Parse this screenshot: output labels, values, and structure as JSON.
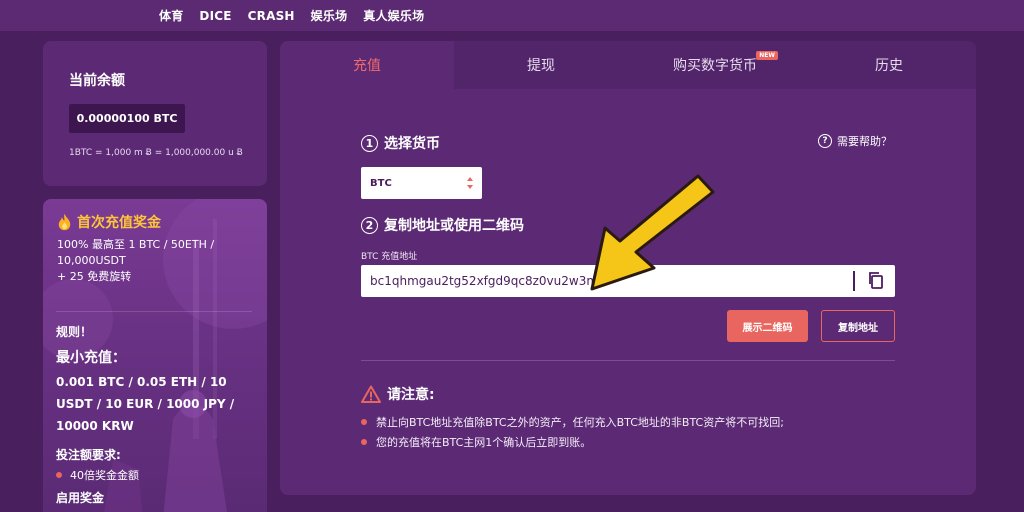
{
  "topnav": {
    "items": [
      "体育",
      "DICE",
      "CRASH",
      "娱乐场",
      "真人娱乐场"
    ]
  },
  "balance": {
    "title": "当前余额",
    "amount": "0.00000100 BTC",
    "conversion": "1BTC = 1,000 m Ƀ = 1,000,000.00 u Ƀ"
  },
  "bonus": {
    "title": "首次充值奖金",
    "line1": "100% 最高至 1 BTC / 50ETH /",
    "line2": "10,000USDT",
    "line3": "+ 25 免费旋转",
    "rules_label": "规则！",
    "min_label": "最小充值：",
    "min_values": "0.001 BTC / 0.05 ETH / 10 USDT / 10 EUR / 1000 JPY / 10000 KRW",
    "wager_label": "投注额要求:",
    "wager_item": "40倍奖金金额",
    "enable_label": "启用奖金"
  },
  "tabs": [
    {
      "label": "充值",
      "active": true
    },
    {
      "label": "提现",
      "active": false
    },
    {
      "label": "购买数字货币",
      "active": false,
      "badge": "NEW"
    },
    {
      "label": "历史",
      "active": false
    }
  ],
  "step1": {
    "num": "1",
    "label": "选择货币"
  },
  "help": {
    "label": "需要帮助？",
    "icon": "question-icon"
  },
  "currency_select": {
    "value": "BTC"
  },
  "step2": {
    "num": "2",
    "label": "复制地址或使用二维码"
  },
  "address": {
    "label": "BTC 充值地址",
    "value": "bc1qhmgau2tg52xfgd9qc8z0vu2w3m"
  },
  "buttons": {
    "show_qr": "展示二维码",
    "copy_address": "复制地址"
  },
  "notice": {
    "title": "请注意:",
    "items": [
      "禁止向BTC地址充值除BTC之外的资产，任何充入BTC地址的非BTC资产将不可找回;",
      "您的充值将在BTC主网1个确认后立即到账。"
    ]
  },
  "colors": {
    "background": "#4a1f5e",
    "panel": "#5c2a74",
    "accent": "#e8665f",
    "gold": "#ffc53a",
    "arrow": "#f5c518"
  }
}
